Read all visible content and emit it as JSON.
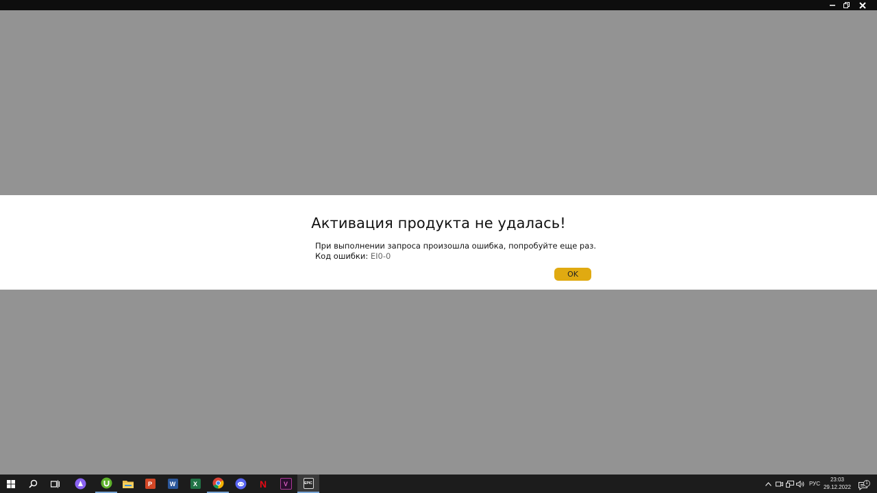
{
  "window": {
    "controls": {
      "minimize_icon": "minimize-icon",
      "restore_icon": "restore-icon",
      "close_icon": "close-icon"
    }
  },
  "dialog": {
    "title": "Активация продукта не удалась!",
    "message": "При выполнении запроса произошла ошибка, попробуйте еще раз.",
    "error_label": "Код ошибки:",
    "error_code": "EI0-0",
    "ok_label": "OK",
    "accent_color": "#e0aa11"
  },
  "taskbar": {
    "apps": [
      {
        "name": "start",
        "icon": "windows-start-icon"
      },
      {
        "name": "search",
        "icon": "search-icon"
      },
      {
        "name": "task-view",
        "icon": "task-view-icon"
      },
      {
        "name": "alice",
        "icon": "alice-assistant-icon"
      },
      {
        "name": "utorrent",
        "icon": "utorrent-icon"
      },
      {
        "name": "file-explorer",
        "icon": "folder-icon"
      },
      {
        "name": "powerpoint",
        "icon": "powerpoint-icon",
        "letter": "P"
      },
      {
        "name": "word",
        "icon": "word-icon",
        "letter": "W"
      },
      {
        "name": "excel",
        "icon": "excel-icon",
        "letter": "X"
      },
      {
        "name": "chrome",
        "icon": "chrome-icon"
      },
      {
        "name": "discord",
        "icon": "discord-icon"
      },
      {
        "name": "netflix",
        "icon": "netflix-icon",
        "letter": "N"
      },
      {
        "name": "vegas",
        "icon": "vegas-icon",
        "letter": "V"
      },
      {
        "name": "epic-games",
        "icon": "epic-games-icon",
        "letter": "EPIC"
      }
    ],
    "tray": {
      "language": "РУС",
      "time": "23:03",
      "date": "29.12.2022",
      "notification_count": "1"
    }
  }
}
